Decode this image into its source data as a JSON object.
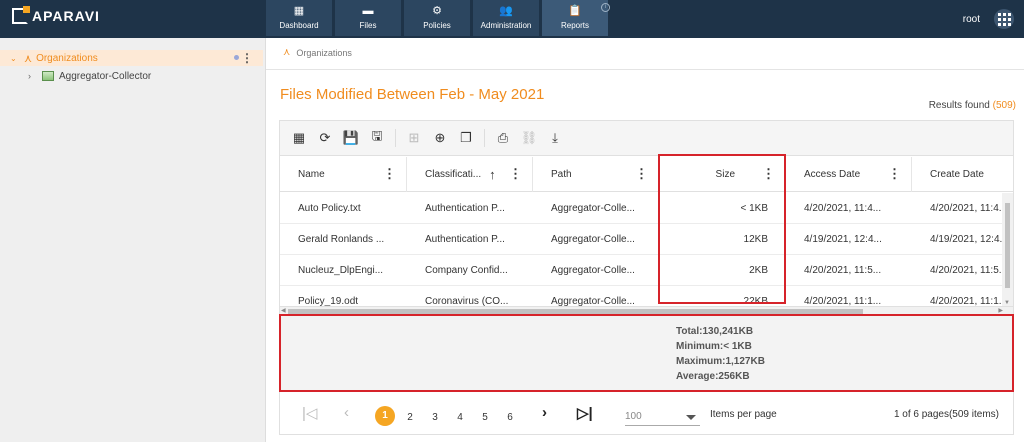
{
  "app": {
    "logo": "APARAVI"
  },
  "nav": {
    "tabs": [
      {
        "label": "Dashboard",
        "icon": "dashboard-icon"
      },
      {
        "label": "Files",
        "icon": "folder-icon"
      },
      {
        "label": "Policies",
        "icon": "gear-icon"
      },
      {
        "label": "Administration",
        "icon": "users-icon"
      },
      {
        "label": "Reports",
        "icon": "clipboard-icon"
      }
    ],
    "active_tab": "Reports"
  },
  "user": {
    "name": "root"
  },
  "sidebar": {
    "tree": {
      "root_label": "Organizations",
      "children": [
        {
          "label": "Aggregator-Collector"
        }
      ]
    }
  },
  "breadcrumb": {
    "label": "Organizations"
  },
  "report": {
    "title": "Files Modified Between Feb - May 2021",
    "results_label": "Results found",
    "results_count": "(509)"
  },
  "toolbar": {
    "buttons": [
      "grid-icon",
      "refresh-icon",
      "save-icon",
      "save-as-icon",
      "columns-icon",
      "add-icon",
      "copy-icon",
      "print-icon",
      "link-icon",
      "download-icon"
    ]
  },
  "table": {
    "columns": {
      "name": "Name",
      "classification": "Classificati...",
      "path": "Path",
      "size": "Size",
      "access": "Access Date",
      "create": "Create Date"
    },
    "rows": [
      {
        "name": "Auto Policy.txt",
        "classification": "Authentication P...",
        "path": "Aggregator-Colle...",
        "size": "< 1KB",
        "access": "4/20/2021, 11:4...",
        "create": "4/20/2021, 11:4..."
      },
      {
        "name": "Gerald Ronlands ...",
        "classification": "Authentication P...",
        "path": "Aggregator-Colle...",
        "size": "12KB",
        "access": "4/19/2021, 12:4...",
        "create": "4/19/2021, 12:4..."
      },
      {
        "name": "Nucleuz_DlpEngi...",
        "classification": "Company Confid...",
        "path": "Aggregator-Colle...",
        "size": "2KB",
        "access": "4/20/2021, 11:5...",
        "create": "4/20/2021, 11:5..."
      },
      {
        "name": "Policy_19.odt",
        "classification": "Coronavirus (CO...",
        "path": "Aggregator-Colle...",
        "size": "22KB",
        "access": "4/20/2021, 11:1...",
        "create": "4/20/2021, 11:1..."
      }
    ]
  },
  "summary": {
    "total": "Total:130,241KB",
    "minimum": "Minimum:< 1KB",
    "maximum": "Maximum:1,127KB",
    "average": "Average:256KB"
  },
  "pager": {
    "pages": [
      "1",
      "2",
      "3",
      "4",
      "5",
      "6"
    ],
    "current": "1",
    "per_page": "100",
    "per_page_label": "Items per page",
    "info": "1 of 6 pages(509 items)"
  },
  "colors": {
    "accent": "#f08c1e",
    "topbar": "#1e3348",
    "highlight": "#d6232a",
    "page_active": "#f5a623"
  }
}
